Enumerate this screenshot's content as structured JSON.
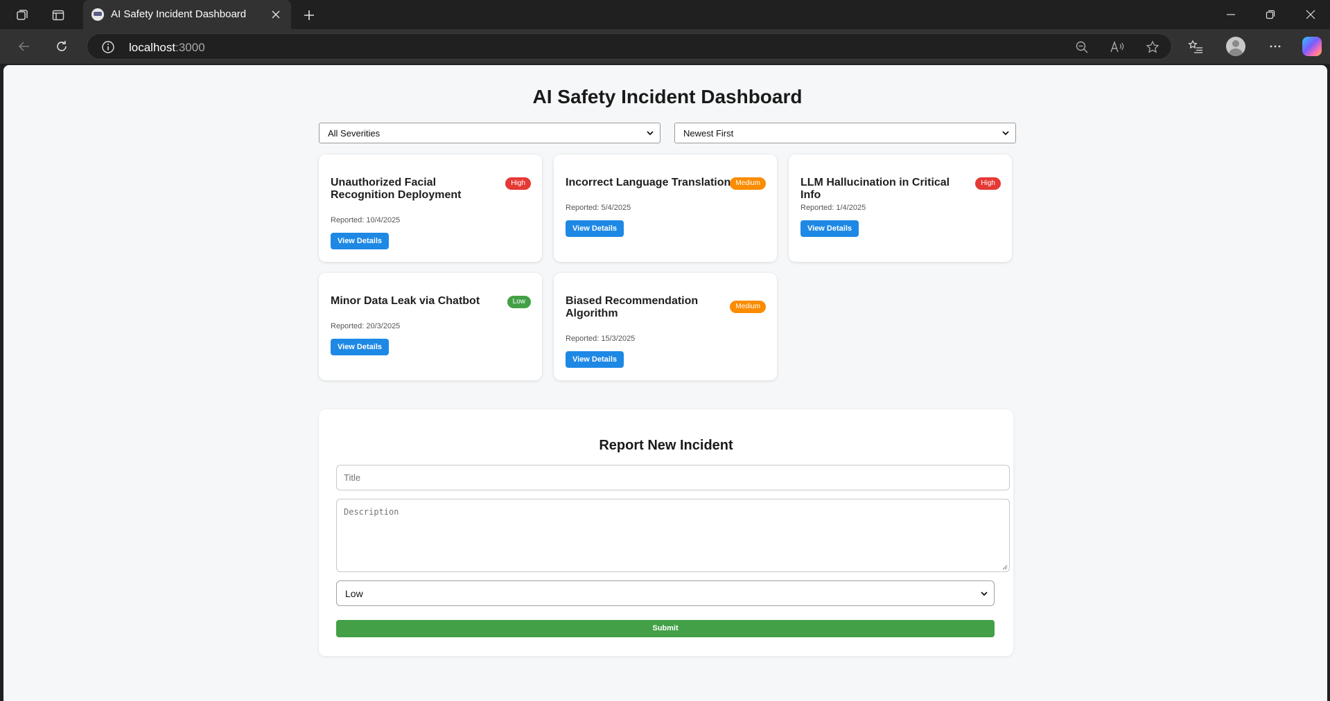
{
  "browser": {
    "tab_title": "AI Safety Incident Dashboard",
    "url_host": "localhost",
    "url_port": ":3000"
  },
  "page": {
    "title": "AI Safety Incident Dashboard",
    "severity_filter": "All Severities",
    "sort_order": "Newest First",
    "view_details_label": "View Details"
  },
  "incidents": [
    {
      "title": "Unauthorized Facial Recognition Deployment",
      "severity": "High",
      "reported": "Reported: 10/4/2025"
    },
    {
      "title": "Incorrect Language Translation",
      "severity": "Medium",
      "reported": "Reported: 5/4/2025"
    },
    {
      "title": "LLM Hallucination in Critical Info",
      "severity": "High",
      "reported": "Reported: 1/4/2025"
    },
    {
      "title": "Minor Data Leak via Chatbot",
      "severity": "Low",
      "reported": "Reported: 20/3/2025"
    },
    {
      "title": "Biased Recommendation Algorithm",
      "severity": "Medium",
      "reported": "Reported: 15/3/2025"
    }
  ],
  "form": {
    "heading": "Report New Incident",
    "title_placeholder": "Title",
    "description_placeholder": "Description",
    "severity_value": "Low",
    "submit_label": "Submit"
  },
  "colors": {
    "high": "#e53935",
    "medium": "#fb8c00",
    "low": "#43a047",
    "primary": "#1e88e5"
  }
}
